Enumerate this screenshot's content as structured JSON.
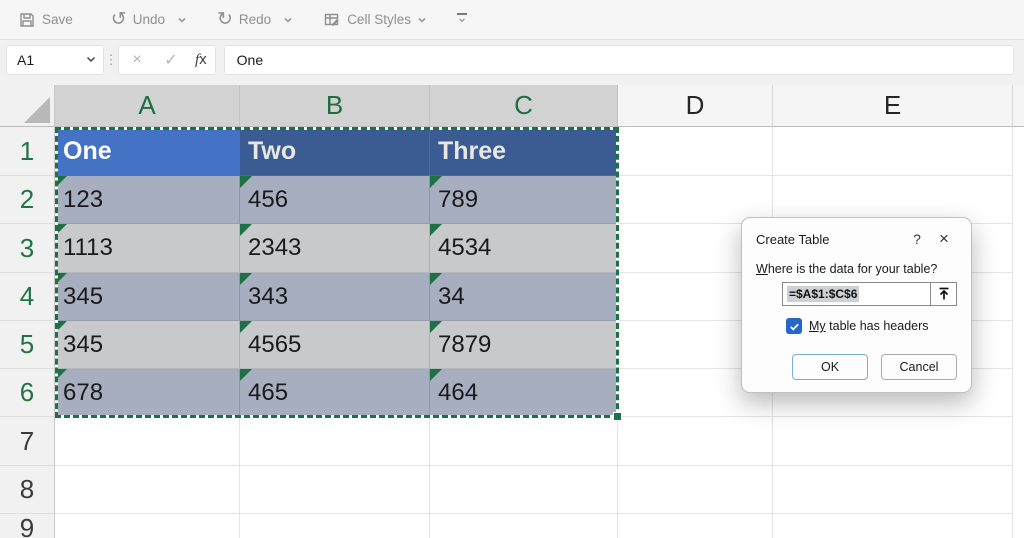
{
  "toolbar": {
    "save_label": "Save",
    "undo_label": "Undo",
    "redo_label": "Redo",
    "cell_styles_label": "Cell Styles"
  },
  "formula_bar": {
    "name_box_value": "A1",
    "cancel_glyph": "×",
    "enter_glyph": "✓",
    "fx_label": "fx",
    "formula_value": "One"
  },
  "sheet": {
    "columns": [
      "A",
      "B",
      "C",
      "D",
      "E"
    ],
    "selected_columns": [
      "A",
      "B",
      "C"
    ],
    "selected_range": "A1:C6",
    "active_cell": "A1",
    "rows": [
      {
        "n": "1",
        "cells": [
          "One",
          "Two",
          "Three"
        ]
      },
      {
        "n": "2",
        "cells": [
          "123",
          "456",
          "789"
        ]
      },
      {
        "n": "3",
        "cells": [
          "1113",
          "2343",
          "4534"
        ]
      },
      {
        "n": "4",
        "cells": [
          "345",
          "343",
          "34"
        ]
      },
      {
        "n": "5",
        "cells": [
          "345",
          "4565",
          "7879"
        ]
      },
      {
        "n": "6",
        "cells": [
          "678",
          "465",
          "464"
        ]
      },
      {
        "n": "7",
        "cells": []
      },
      {
        "n": "8",
        "cells": []
      },
      {
        "n": "9",
        "cells": []
      }
    ]
  },
  "dialog": {
    "title": "Create Table",
    "help_glyph": "?",
    "close_glyph": "×",
    "question_underlined": "W",
    "question_rest": "here is the data for your table?",
    "range_value": "=$A$1:$C$6",
    "checkbox_checked": true,
    "checkbox_label_underlined": "My",
    "checkbox_label_rest": " table has headers",
    "ok_label": "OK",
    "cancel_label": "Cancel"
  },
  "colors": {
    "accent_green": "#217346",
    "ants_green": "#1e7145",
    "active_cell_blue": "#4472c4",
    "selected_header_blue": "#3b5c92",
    "selection_row_dark": "#a7aec0",
    "selection_row_light": "#c7c9ca",
    "checkbox_blue": "#2566c9",
    "ok_border_blue": "#79aedb"
  }
}
